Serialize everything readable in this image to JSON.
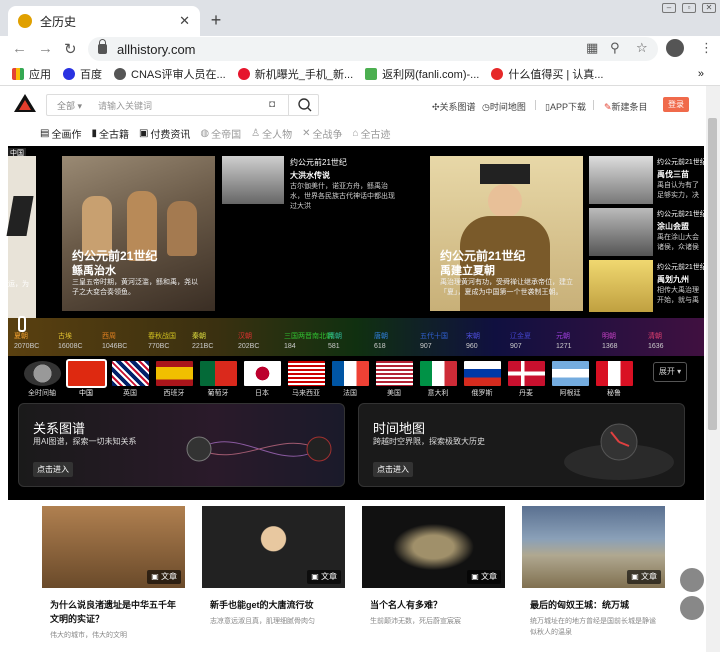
{
  "browser": {
    "tab_title": "全历史",
    "new_tab": "+",
    "url": "allhistory.com",
    "bookmarks": [
      {
        "label": "应用",
        "color": "#e34234"
      },
      {
        "label": "百度",
        "color": "#2932e1"
      },
      {
        "label": "CNAS评审人员在...",
        "color": "#555555"
      },
      {
        "label": "新机曝光_手机_新...",
        "color": "#e6162d"
      },
      {
        "label": "返利网(fanli.com)-...",
        "color": "#4caf50"
      },
      {
        "label": "什么值得买 | 认真...",
        "color": "#e62828"
      }
    ],
    "more": "»"
  },
  "site": {
    "search_scope": "全部",
    "search_placeholder": "请输入关键词",
    "header_links": [
      "关系图谱",
      "时间地图",
      "APP下载",
      "新建条目"
    ],
    "login": "登录",
    "categories": [
      {
        "label": "全画作",
        "dim": false
      },
      {
        "label": "全古籍",
        "dim": false
      },
      {
        "label": "付费资讯",
        "dim": false
      },
      {
        "label": "全帝国",
        "dim": true
      },
      {
        "label": "全人物",
        "dim": true
      },
      {
        "label": "全战争",
        "dim": true
      },
      {
        "label": "全古迹",
        "dim": true
      }
    ]
  },
  "hero": {
    "region_label": "中国",
    "left_edge_text": "运，为",
    "main1": {
      "title1": "约公元前21世纪",
      "title2": "鲧禹治水",
      "desc": "三皇五帝时期，黄河泛滥，鲧和禹，尧以子之大变合奏领鱼。"
    },
    "main1_side": {
      "title": "约公元前21世纪",
      "subtitle": "大洪水传说",
      "desc": "古尔伽美什，诺亚方舟，鲧禹治水，世界各民族古代神话中都出现过大洪"
    },
    "main2": {
      "title1": "约公元前21世纪",
      "title2": "禹建立夏朝",
      "desc": "禹治理黄河有功，受舜禅让继承帝位，建立「夏」，夏成为中国第一个世袭制王朝。"
    },
    "right_items": [
      {
        "title": "约公元前21世纪",
        "subtitle": "禹伐三苗",
        "desc": "禹自认为有了足够实力，决定再次征伐三苗"
      },
      {
        "title": "约公元前21世纪",
        "subtitle": "涂山会盟",
        "desc": "禹在涂山大会诸侯，众诸侯前来大会"
      },
      {
        "title": "约公元前21世纪",
        "subtitle": "禹划九州",
        "desc": "相传大禹治理开始，就与禹划分九州"
      }
    ]
  },
  "timeline": [
    {
      "name": "夏朝",
      "year": "2070BC",
      "color": "#f0a030"
    },
    {
      "name": "古埃",
      "year": "16008C",
      "color": "#e0c030"
    },
    {
      "name": "西周",
      "year": "1046BC",
      "color": "#e08020"
    },
    {
      "name": "春秋战国",
      "year": "770BC",
      "color": "#d0c020"
    },
    {
      "name": "秦朝",
      "year": "221BC",
      "color": "#e0e040"
    },
    {
      "name": "汉朝",
      "year": "202BC",
      "color": "#e03030"
    },
    {
      "name": "三国两晋南北朝",
      "year": "184",
      "color": "#30c030"
    },
    {
      "name": "隋朝",
      "year": "581",
      "color": "#30c0a0"
    },
    {
      "name": "唐朝",
      "year": "618",
      "color": "#3080e0"
    },
    {
      "name": "五代十国",
      "year": "907",
      "color": "#3060d0"
    },
    {
      "name": "宋朝",
      "year": "960",
      "color": "#5050e0"
    },
    {
      "name": "辽金夏",
      "year": "907",
      "color": "#4040c0"
    },
    {
      "name": "元朝",
      "year": "1271",
      "color": "#a040e0"
    },
    {
      "name": "明朝",
      "year": "1368",
      "color": "#c040c0"
    },
    {
      "name": "清朝",
      "year": "1636",
      "color": "#e04070"
    }
  ],
  "flags": [
    "全时间轴",
    "中国",
    "英国",
    "西班牙",
    "葡萄牙",
    "日本",
    "马来西亚",
    "法国",
    "美国",
    "意大利",
    "俄罗斯",
    "丹麦",
    "阿根廷",
    "秘鲁"
  ],
  "expand": "展开",
  "panels": [
    {
      "title": "关系图谱",
      "desc": "用AI图谱，探索一切未知关系",
      "button": "点击进入"
    },
    {
      "title": "时间地图",
      "desc": "跨越时空界限，探索极致大历史",
      "button": "点击进入"
    }
  ],
  "articles": [
    {
      "tag": "文章",
      "title": "为什么说良渚遗址是中华五千年文明的实证？",
      "sub": "伟大的城市，伟大的文明"
    },
    {
      "tag": "文章",
      "title": "新手也能get的大唐流行妆",
      "sub": "志凉意远淑且真，肌理细腻骨肉匀"
    },
    {
      "tag": "文章",
      "title": "当个名人有多难？",
      "sub": "生前颠沛无数，死后蔚宣宸宸"
    },
    {
      "tag": "文章",
      "title": "最后的匈奴王城：统万城",
      "sub": "统万城址在的地方曾经是国前长城是静谧似秋人的温泉"
    }
  ]
}
